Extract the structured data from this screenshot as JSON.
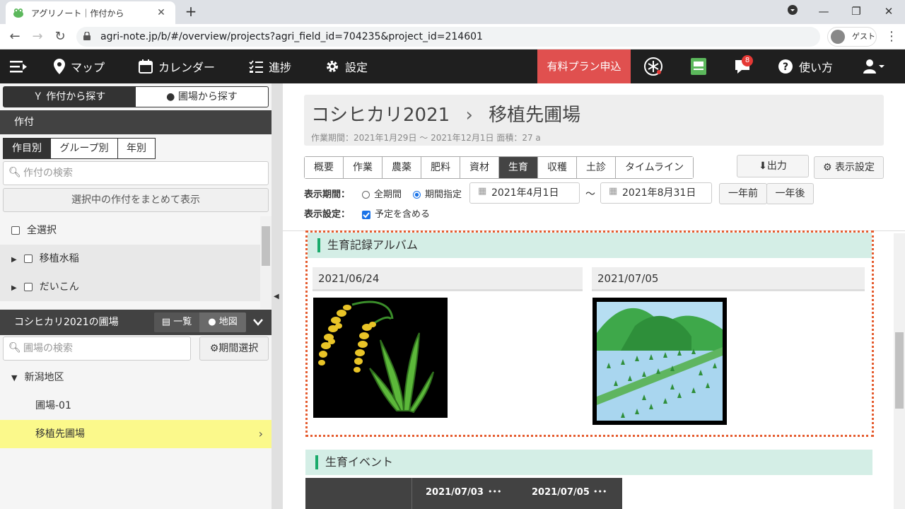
{
  "browser": {
    "tab_title": "アグリノート｜作付から",
    "url": "agri-note.jp/b/#/overview/projects?agri_field_id=704235&project_id=214601",
    "profile_label": "ゲスト"
  },
  "nav": {
    "map": "マップ",
    "calendar": "カレンダー",
    "progress": "進捗",
    "settings": "設定",
    "paid_plan": "有料プラン申込",
    "notif_count": "8",
    "help": "使い方"
  },
  "left": {
    "tab_crop": "作付から探す",
    "tab_field": "圃場から探す",
    "crop_header": "作付",
    "seg_item": "作目別",
    "seg_group": "グループ別",
    "seg_year": "年別",
    "crop_search_placeholder": "作付の検索",
    "show_selected": "選択中の作付をまとめて表示",
    "select_all": "全選択",
    "crops": [
      "移植水稲",
      "だいこん"
    ],
    "field_header": "コシヒカリ2021の圃場",
    "view_list": "一覧",
    "view_map": "地図",
    "field_search_placeholder": "圃場の検索",
    "period_select": "期間選択",
    "region": "新潟地区",
    "fields": [
      "圃場-01",
      "移植先圃場"
    ]
  },
  "main": {
    "crop_name": "コシヒカリ2021",
    "field_name": "移植先圃場",
    "meta": "作業期間：2021年1月29日 〜 2021年12月1日  面積：27 a",
    "tabs": [
      "概要",
      "作業",
      "農薬",
      "肥料",
      "資材",
      "生育",
      "収穫",
      "土診",
      "タイムライン"
    ],
    "active_tab": "生育",
    "export": "出力",
    "display_settings": "表示設定",
    "period_label": "表示期間：",
    "opt_all": "全期間",
    "opt_range": "期間指定",
    "date_from": "2021年4月1日",
    "tilde": "〜",
    "date_to": "2021年8月31日",
    "prev_year": "一年前",
    "next_year": "一年後",
    "settings_label": "表示設定：",
    "include_planned": "予定を含める",
    "album_title": "生育記録アルバム",
    "album_dates": [
      "2021/06/24",
      "2021/07/05"
    ],
    "events_title": "生育イベント",
    "event_dates": [
      "2021/07/03",
      "2021/07/05"
    ],
    "more": "•••"
  }
}
